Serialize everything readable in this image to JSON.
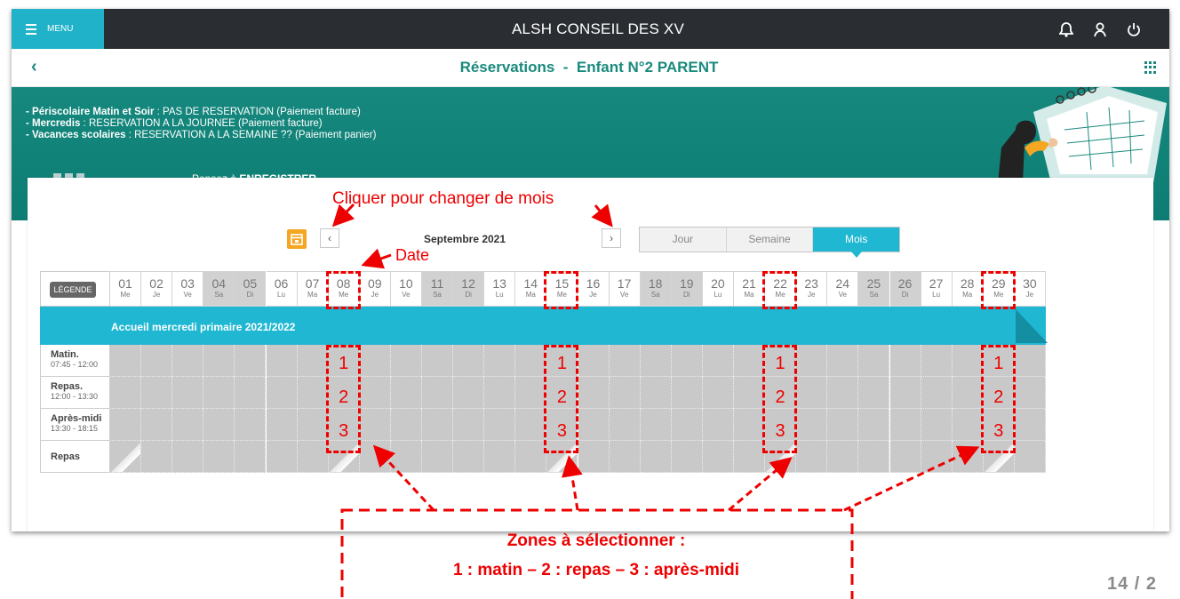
{
  "topbar": {
    "menu_label": "MENU",
    "app_title": "ALSH CONSEIL DES XV"
  },
  "subbar": {
    "title": "Réservations  -  Enfant N°2 PARENT"
  },
  "banner": {
    "lines": [
      {
        "bold": "- Périscolaire Matin et Soir",
        "text": " : PAS DE RESERVATION (Paiement facture)"
      },
      {
        "bold": "- Mercredis",
        "text": " : RESERVATION A LA JOURNEE (Paiement facture)"
      },
      {
        "bold": "- Vacances scolaires",
        "text": " : RESERVATION A LA SEMAINE ?? (Paiement panier)"
      }
    ],
    "remember_prefix": "Pensez à ",
    "remember_bold": "ENREGISTRER"
  },
  "calendar": {
    "month": "Septembre 2021",
    "views": [
      "Jour",
      "Semaine",
      "Mois"
    ],
    "active_view": "Mois",
    "legend_label": "LÉGENDE",
    "days": [
      {
        "n": "01",
        "w": "Me",
        "weekend": false
      },
      {
        "n": "02",
        "w": "Je",
        "weekend": false
      },
      {
        "n": "03",
        "w": "Ve",
        "weekend": false
      },
      {
        "n": "04",
        "w": "Sa",
        "weekend": true
      },
      {
        "n": "05",
        "w": "Di",
        "weekend": true
      },
      {
        "n": "06",
        "w": "Lu",
        "weekend": false
      },
      {
        "n": "07",
        "w": "Ma",
        "weekend": false
      },
      {
        "n": "08",
        "w": "Me",
        "weekend": false
      },
      {
        "n": "09",
        "w": "Je",
        "weekend": false
      },
      {
        "n": "10",
        "w": "Ve",
        "weekend": false
      },
      {
        "n": "11",
        "w": "Sa",
        "weekend": true
      },
      {
        "n": "12",
        "w": "Di",
        "weekend": true
      },
      {
        "n": "13",
        "w": "Lu",
        "weekend": false
      },
      {
        "n": "14",
        "w": "Ma",
        "weekend": false
      },
      {
        "n": "15",
        "w": "Me",
        "weekend": false
      },
      {
        "n": "16",
        "w": "Je",
        "weekend": false
      },
      {
        "n": "17",
        "w": "Ve",
        "weekend": false
      },
      {
        "n": "18",
        "w": "Sa",
        "weekend": true
      },
      {
        "n": "19",
        "w": "Di",
        "weekend": true
      },
      {
        "n": "20",
        "w": "Lu",
        "weekend": false
      },
      {
        "n": "21",
        "w": "Ma",
        "weekend": false
      },
      {
        "n": "22",
        "w": "Me",
        "weekend": false
      },
      {
        "n": "23",
        "w": "Je",
        "weekend": false
      },
      {
        "n": "24",
        "w": "Ve",
        "weekend": false
      },
      {
        "n": "25",
        "w": "Sa",
        "weekend": true
      },
      {
        "n": "26",
        "w": "Di",
        "weekend": true
      },
      {
        "n": "27",
        "w": "Lu",
        "weekend": false
      },
      {
        "n": "28",
        "w": "Ma",
        "weekend": false
      },
      {
        "n": "29",
        "w": "Me",
        "weekend": false
      },
      {
        "n": "30",
        "w": "Je",
        "weekend": false
      }
    ],
    "activity": "Accueil mercredi primaire 2021/2022",
    "rows": [
      {
        "name": "Matin.",
        "time": "07:45 - 12:00"
      },
      {
        "name": "Repas.",
        "time": "12:00 - 13:30"
      },
      {
        "name": "Après-midi",
        "time": "13:30 - 18:15"
      },
      {
        "name": "Repas",
        "time": ""
      }
    ]
  },
  "annotations": {
    "change_month": "Cliquer pour changer de mois",
    "date": "Date",
    "zones_line1": "Zones à sélectionner :",
    "zones_line2": "1 : matin – 2 : repas – 3 : après-midi",
    "markers": [
      "1",
      "2",
      "3"
    ]
  },
  "page_number": "14 / 2",
  "colors": {
    "topbar": "#2a2e33",
    "accent": "#1fb7d2",
    "teal": "#16887e",
    "annotation": "#e00000"
  }
}
